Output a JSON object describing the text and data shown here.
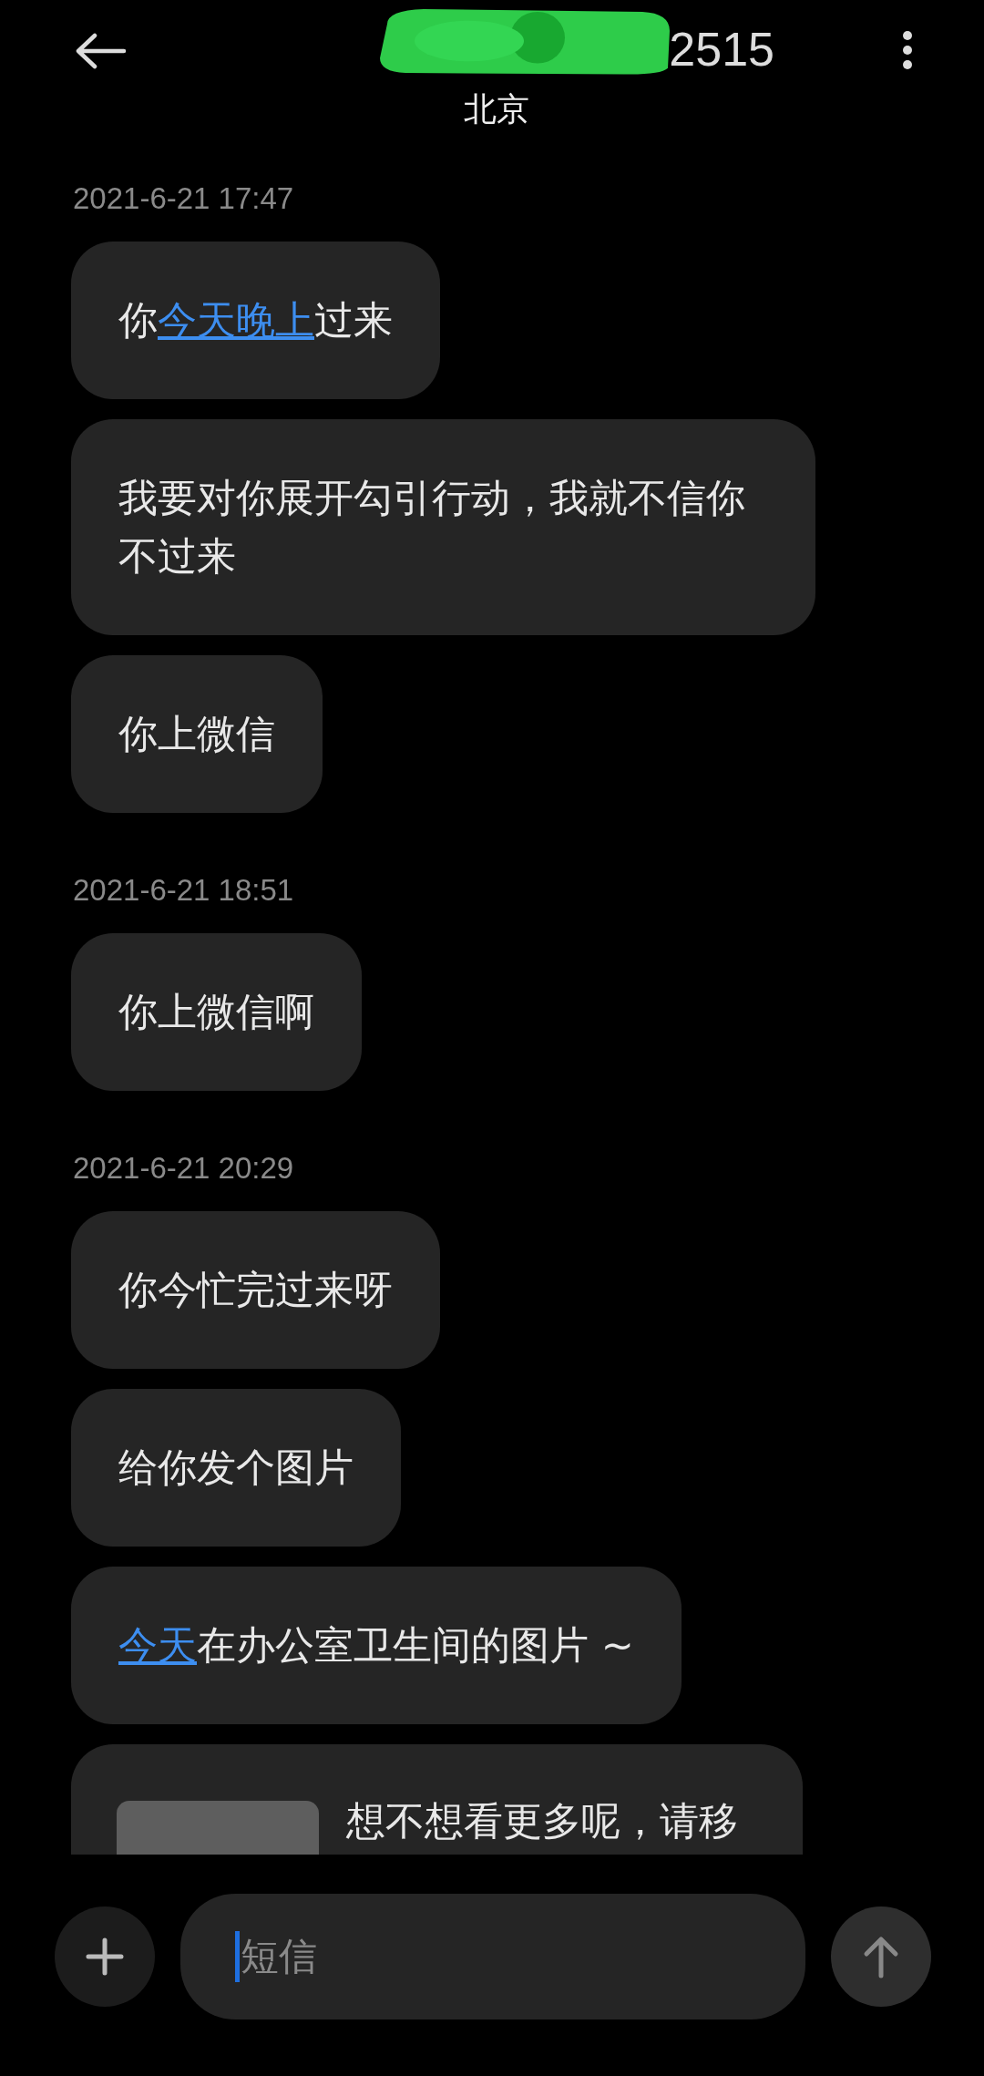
{
  "header": {
    "title": "2515",
    "subtitle": "北京"
  },
  "groups": [
    {
      "time": "2021-6-21 17:47",
      "messages": [
        {
          "kind": "text",
          "parts": [
            {
              "text": "你",
              "link": false
            },
            {
              "text": "今天晚上",
              "link": true
            },
            {
              "text": "过来",
              "link": false
            }
          ]
        },
        {
          "kind": "text",
          "parts": [
            {
              "text": "我要对你展开勾引行动，我就不信你不过来",
              "link": false
            }
          ]
        },
        {
          "kind": "text",
          "parts": [
            {
              "text": "你上微信",
              "link": false
            }
          ]
        }
      ]
    },
    {
      "time": "2021-6-21 18:51",
      "messages": [
        {
          "kind": "text",
          "parts": [
            {
              "text": "你上微信啊",
              "link": false
            }
          ]
        }
      ]
    },
    {
      "time": "2021-6-21 20:29",
      "messages": [
        {
          "kind": "text",
          "parts": [
            {
              "text": "你今忙完过来呀",
              "link": false
            }
          ]
        },
        {
          "kind": "text",
          "parts": [
            {
              "text": "给你发个图片",
              "link": false
            }
          ]
        },
        {
          "kind": "text",
          "parts": [
            {
              "text": "今天",
              "link": true
            },
            {
              "text": "在办公室卫生间的图片 ~",
              "link": false
            }
          ]
        },
        {
          "kind": "card",
          "parts": [
            {
              "text": "想不想看更多呢，请移",
              "link": false
            }
          ]
        }
      ]
    }
  ],
  "composer": {
    "placeholder": "短信"
  }
}
